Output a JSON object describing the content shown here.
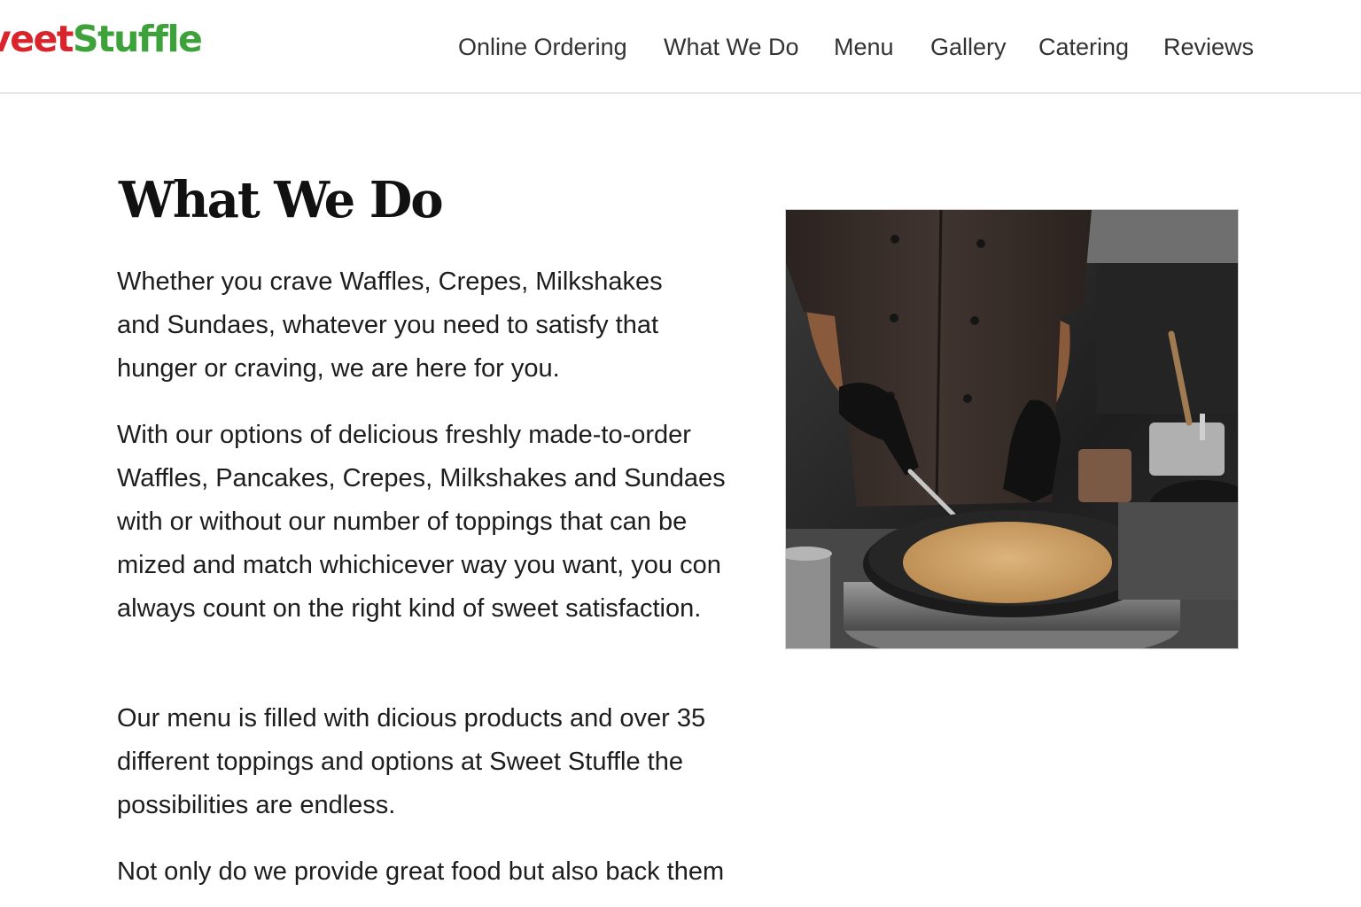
{
  "header": {
    "logo": {
      "part1": "veet",
      "part2": "Stuffle"
    },
    "nav": [
      {
        "label": "Online Ordering"
      },
      {
        "label": "What We Do"
      },
      {
        "label": "Menu"
      },
      {
        "label": "Gallery"
      },
      {
        "label": "Catering"
      },
      {
        "label": "Reviews"
      }
    ]
  },
  "main": {
    "title": "What We Do",
    "paragraphs": [
      "Whether you crave Waffles, Crepes, Milkshakes and Sundaes, whatever you need to satisfy that hunger or craving, we are here for you.",
      "With our options of delicious freshly made-to-order Waffles, Pancakes, Crepes, Milkshakes and Sundaes with or without our number of toppings that can be mized and match whichicever way you want, you con always count on the right kind of sweet satisfaction.",
      "Our menu is filled with dicious products and over 35 different toppings and options at Sweet Stuffle the possibilities are endless.",
      "Not only do we provide great food but also back them"
    ]
  },
  "colors": {
    "logo_red": "#d8242a",
    "logo_green": "#3ea23a"
  },
  "icons": {
    "photo": "chef-making-crepe-image"
  }
}
